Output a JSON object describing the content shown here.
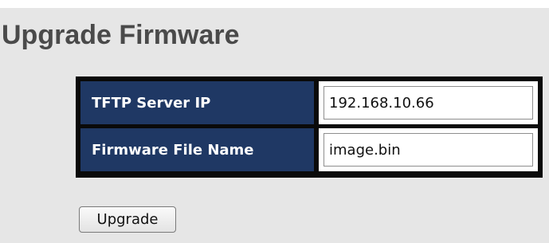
{
  "page": {
    "title": "Upgrade Firmware"
  },
  "form": {
    "tftp_server_ip": {
      "label": "TFTP Server IP",
      "value": "192.168.10.66"
    },
    "firmware_file_name": {
      "label": "Firmware File Name",
      "value": "image.bin"
    }
  },
  "actions": {
    "upgrade_label": "Upgrade"
  },
  "colors": {
    "background": "#e6e6e6",
    "label_cell": "#1f3864",
    "table_border": "#0a0a0a",
    "title_text": "#4a4a4a"
  }
}
